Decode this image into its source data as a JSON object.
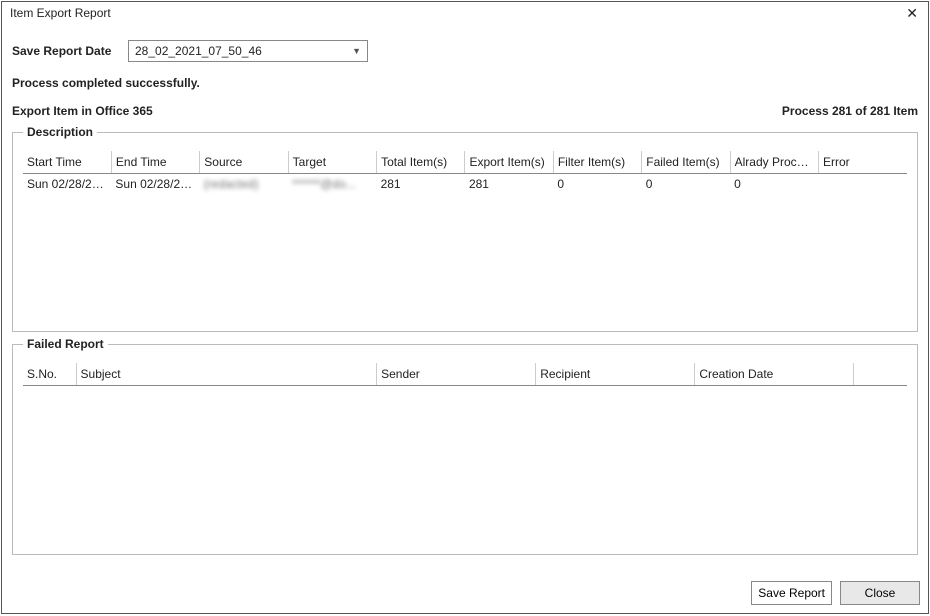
{
  "window": {
    "title": "Item Export Report"
  },
  "save_date": {
    "label": "Save Report Date",
    "value": "28_02_2021_07_50_46"
  },
  "status": "Process completed successfully.",
  "export_label": "Export Item in Office 365",
  "progress": "Process 281 of 281 Item",
  "description": {
    "title": "Description",
    "columns": [
      "Start Time",
      "End Time",
      "Source",
      "Target",
      "Total Item(s)",
      "Export Item(s)",
      "Filter Item(s)",
      "Failed Item(s)",
      "Alrady Proces...",
      "Error"
    ],
    "rows": [
      {
        "start": "Sun 02/28/202...",
        "end": "Sun 02/28/20...",
        "source": "(redacted)",
        "target": "******@do...",
        "total": "281",
        "export": "281",
        "filter": "0",
        "failed": "0",
        "already": "0",
        "error": ""
      }
    ]
  },
  "failed": {
    "title": "Failed Report",
    "columns": [
      "S.No.",
      "Subject",
      "Sender",
      "Recipient",
      "Creation Date",
      ""
    ]
  },
  "buttons": {
    "save": "Save Report",
    "close": "Close"
  }
}
